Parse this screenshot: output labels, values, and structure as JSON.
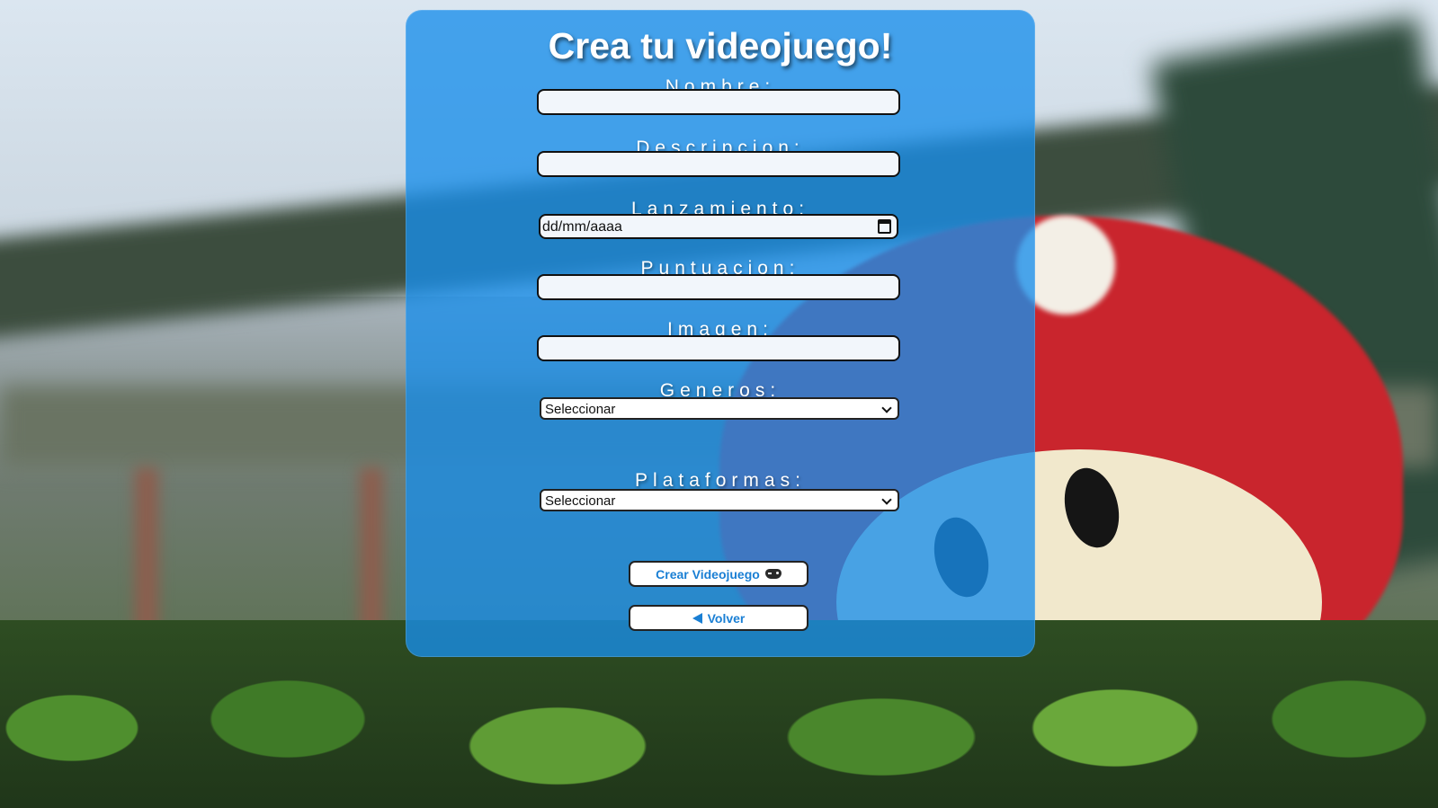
{
  "form": {
    "title": "Crea tu videojuego!",
    "fields": {
      "nombre": {
        "label": "Nombre:",
        "value": ""
      },
      "descripcion": {
        "label": "Descripcion:",
        "value": ""
      },
      "lanzamiento": {
        "label": "Lanzamiento:",
        "placeholder": "dd/mm/aaaa"
      },
      "puntuacion": {
        "label": "Puntuacion:",
        "value": ""
      },
      "imagen": {
        "label": "Imagen:",
        "value": ""
      },
      "generos": {
        "label": "Generos:",
        "selected": "Seleccionar"
      },
      "plataformas": {
        "label": "Plataformas:",
        "selected": "Seleccionar"
      }
    },
    "buttons": {
      "crear": {
        "label": "Crear Videojuego",
        "icon": "gamepad-icon"
      },
      "volver": {
        "label": "Volver",
        "icon": "triangle-left-icon"
      }
    }
  },
  "colors": {
    "panel": "#188EEA",
    "button_text": "#1A7FD4"
  },
  "background": {
    "subject": "mushroom-toy-photo"
  }
}
